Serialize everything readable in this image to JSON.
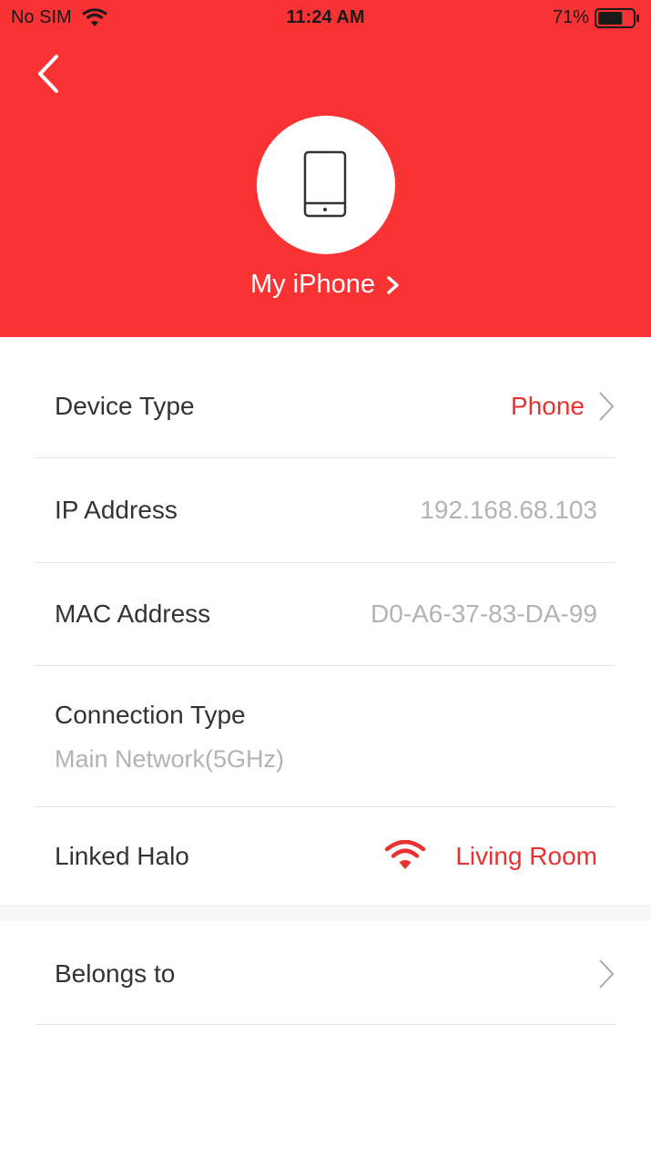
{
  "status_bar": {
    "carrier": "No SIM",
    "time": "11:24 AM",
    "battery_percent": "71%",
    "battery_level": 0.71
  },
  "header": {
    "device_name": "My iPhone",
    "accent_color": "#f93334"
  },
  "details": {
    "device_type": {
      "label": "Device Type",
      "value": "Phone"
    },
    "ip_address": {
      "label": "IP Address",
      "value": "192.168.68.103"
    },
    "mac_address": {
      "label": "MAC Address",
      "value": "D0-A6-37-83-DA-99"
    },
    "connection_type": {
      "label": "Connection Type",
      "value": "Main Network(5GHz)"
    },
    "linked_halo": {
      "label": "Linked Halo",
      "value": "Living Room"
    }
  },
  "belongs_to": {
    "label": "Belongs to"
  },
  "icons": {
    "back": "chevron-left-icon",
    "device": "phone-icon",
    "wifi": "wifi-icon"
  }
}
